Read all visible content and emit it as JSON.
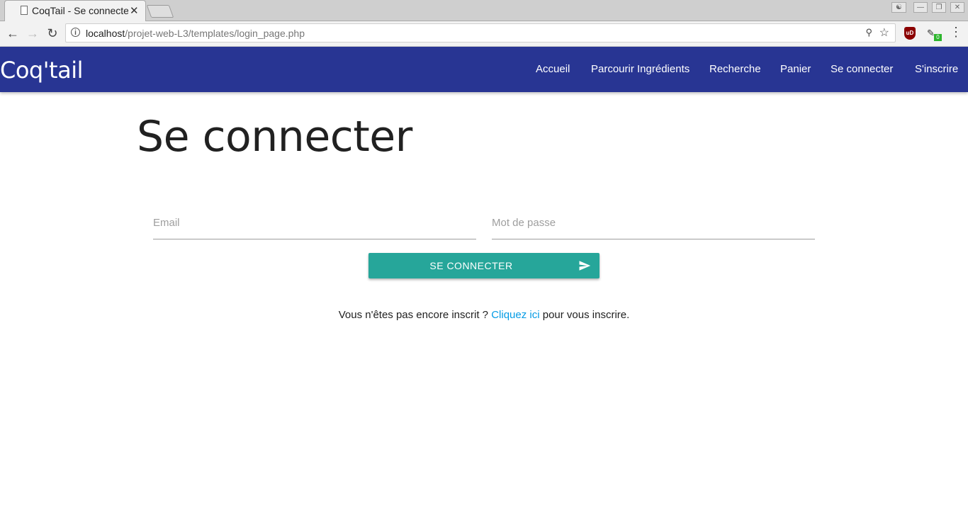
{
  "browser": {
    "tab_title": "CoqTail - Se connecter",
    "tab_close": "✕",
    "url_host": "localhost",
    "url_path": "/projet-web-L3/templates/login_page.php",
    "ublock_label": "uD",
    "ext_badge": "0"
  },
  "site": {
    "brand": "Coq'tail",
    "nav": [
      "Accueil",
      "Parcourir Ingrédients",
      "Recherche",
      "Panier",
      "Se connecter",
      "S'inscrire"
    ]
  },
  "main": {
    "title": "Se connecter",
    "email_placeholder": "Email",
    "password_placeholder": "Mot de passe",
    "submit_label": "SE CONNECTER",
    "register_prefix": "Vous n'êtes pas encore inscrit ?",
    "register_link": "Cliquez ici",
    "register_suffix": "pour vous inscrire."
  },
  "colors": {
    "nav_bg": "#283593",
    "button_bg": "#26a69a",
    "link": "#039be5"
  }
}
